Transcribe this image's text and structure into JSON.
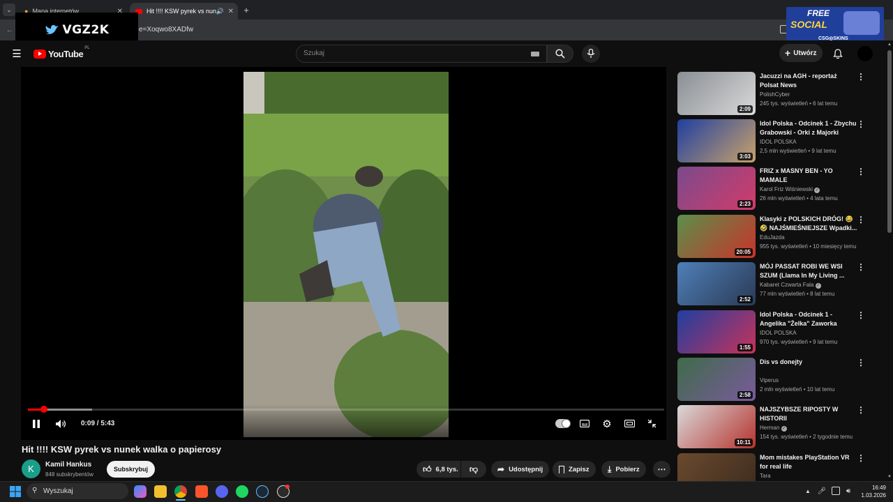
{
  "browser": {
    "tabs": [
      {
        "label": "Mapa internetów",
        "active": false
      },
      {
        "label": "Hit !!!! KSW pyrek vs nunek",
        "active": true
      }
    ],
    "new_tab": "+",
    "url": "e=Xoqwo8XADfw"
  },
  "overlay": {
    "logo_text": "VGZ2K"
  },
  "ad": {
    "line1": "FREE",
    "line2": "SOCIAL",
    "brand": "CSG◎SKINS"
  },
  "header": {
    "logo": "YouTube",
    "region": "PL",
    "search_placeholder": "Szukaj",
    "create_label": "Utwórz"
  },
  "player": {
    "time": "0:09 / 5:43",
    "progress_fraction": 0.027
  },
  "video": {
    "title": "Hit !!!! KSW pyrek vs nunek walka o papierosy",
    "channel": "Kamil Hankus",
    "subscribers": "848 subskrybentów",
    "subscribe_label": "Subskrybuj",
    "likes": "6,8 tys.",
    "share_label": "Udostępnij",
    "save_label": "Zapisz",
    "download_label": "Pobierz"
  },
  "recommendations": [
    {
      "title": "Jacuzzi na AGH - reportaż Polsat News",
      "channel": "PolishCyber",
      "meta": "245 tys. wyświetleń • 6 lat temu",
      "duration": "2:09",
      "verified": false,
      "thumb_colors": [
        "#8a8f94",
        "#d9d9d9"
      ]
    },
    {
      "title": "Idol Polska - Odcinek 1 - Zbychu Grabowski - Orki z Majorki",
      "channel": "IDOL POLSKA",
      "meta": "2,5 mln wyświetleń • 9 lat temu",
      "duration": "3:03",
      "verified": false,
      "thumb_colors": [
        "#1f3fa0",
        "#c9a26b"
      ]
    },
    {
      "title": "FRIZ x MASNY BEN - YO MAMALE",
      "channel": "Karol Friz Wiśniewski",
      "meta": "26 mln wyświetleń • 4 lata temu",
      "duration": "2:23",
      "verified": true,
      "thumb_colors": [
        "#7a4a8c",
        "#d23b6a"
      ]
    },
    {
      "title": "Klasyki z POLSKICH DRÓG! 😂 🤣 NAJŚMIEŚNIEJSZE Wpadki...",
      "channel": "EduJazda",
      "meta": "955 tys. wyświetleń • 10 miesięcy temu",
      "duration": "20:05",
      "verified": false,
      "thumb_colors": [
        "#5b8f4a",
        "#c9332b"
      ]
    },
    {
      "title": "MÓJ PASSAT ROBI WE WSI SZUM (Llama In My Living ...",
      "channel": "Kabaret Czwarta Fala",
      "meta": "77 mln wyświetleń • 8 lat temu",
      "duration": "2:52",
      "verified": true,
      "thumb_colors": [
        "#4f7fb8",
        "#2a3a55"
      ]
    },
    {
      "title": "Idol Polska - Odcinek 1 - Angelika \"Żelka\" Zaworka",
      "channel": "IDOL POLSKA",
      "meta": "970 tys. wyświetleń • 9 lat temu",
      "duration": "1:55",
      "verified": false,
      "thumb_colors": [
        "#1f3fa0",
        "#c8325b"
      ]
    },
    {
      "title": "Dis vs donejty",
      "channel": "Viperus",
      "meta": "2 mln wyświetleń • 10 lat temu",
      "duration": "2:58",
      "verified": false,
      "thumb_colors": [
        "#3f6b4a",
        "#7a5a9c"
      ]
    },
    {
      "title": "NAJSZYBSZE RIPOSTY W HISTORII",
      "channel": "Herman",
      "meta": "154 tys. wyświetleń • 2 tygodnie temu",
      "duration": "10:11",
      "verified": true,
      "thumb_colors": [
        "#d9d9d9",
        "#b5332e"
      ]
    },
    {
      "title": "Mom mistakes PlayStation VR for real life",
      "channel": "Tara",
      "meta": "",
      "duration": "",
      "verified": false,
      "thumb_colors": [
        "#6b4a2e",
        "#3a2a1e"
      ]
    }
  ],
  "taskbar": {
    "search_label": "Wyszukaj",
    "time": "16:49",
    "date": "1.03.2026"
  }
}
